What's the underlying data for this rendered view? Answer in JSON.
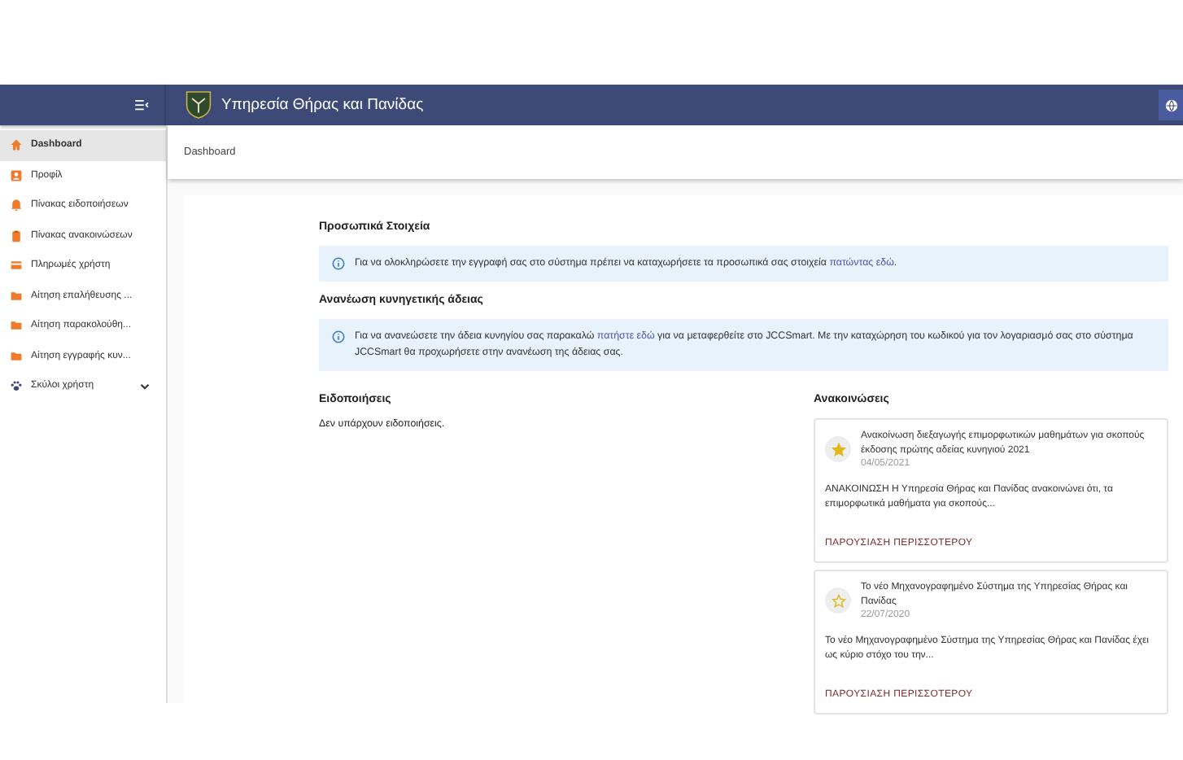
{
  "header": {
    "title": "Υπηρεσία Θήρας και Πανίδας"
  },
  "sidebar": {
    "items": [
      {
        "label": "Dashboard",
        "selected": true
      },
      {
        "label": "Προφίλ",
        "selected": false
      },
      {
        "label": "Πίνακας ειδοποιήσεων",
        "selected": false
      },
      {
        "label": "Πίνακας ανακοινώσεων",
        "selected": false
      },
      {
        "label": "Πληρωμές χρήστη",
        "selected": false
      },
      {
        "label": "Αίτηση επαλήθευσης ...",
        "selected": false
      },
      {
        "label": "Αίτηση παρακολούθη...",
        "selected": false
      },
      {
        "label": "Αίτηση εγγραφής κυν...",
        "selected": false
      },
      {
        "label": "Σκύλοι χρήστη",
        "selected": false,
        "expanded": false
      }
    ]
  },
  "breadcrumb": "Dashboard",
  "sections": [
    {
      "title": "Προσωπικά Στοιχεία",
      "info": {
        "before": "Για να ολοκληρώσετε την εγγραφή σας στο σύστημα πρέπει να καταχωρήσετε τα προσωπικά σας στοιχεία ",
        "link": "πατώντας εδώ",
        "after": "."
      }
    },
    {
      "title": "Ανανέωση κυνηγετικής άδειας",
      "info": {
        "before": "Για να ανανεώσετε την άδεια κυνηγίου σας παρακαλώ ",
        "link": "πατήστε εδώ",
        "after": " για να μεταφερθείτε στο JCCSmart. Με την καταχώρηση του κωδικού για τον λογαριασμό σας στο σύστημα JCCSmart θα προχωρήσετε στην ανανέωση της άδειας σας."
      }
    }
  ],
  "notifications": {
    "title": "Ειδοποιήσεις",
    "empty": "Δεν υπάρχουν ειδοποιήσεις."
  },
  "announcements": {
    "title": "Ανακοινώσεις",
    "items": [
      {
        "title": "Ανακοίνωση διεξαγωγής επιμορφωτικών μαθημάτων για σκοπούς έκδοσης πρώτης αδείας κυνηγιού 2021",
        "date": "04/05/2021",
        "starred": true,
        "body": "ΑΝΑΚΟΙΝΩΣΗ Η Υπηρεσία Θήρας και Πανίδας ανακοινώνει ότι, τα επιμορφωτικά μαθήματα για σκοπούς...",
        "more": "ΠΑΡΟΥΣΙΑΣΗ ΠΕΡΙΣΣΟΤΕΡΟΥ"
      },
      {
        "title": "Το νέο Μηχανογραφημένο Σύστημα της Υπηρεσίας Θήρας και Πανίδας",
        "date": "22/07/2020",
        "starred": false,
        "body": "Το νέο Μηχανογραφημένο Σύστημα της Υπηρεσίας Θήρας και Πανίδας έχει ως κύριο στόχο του την...",
        "more": "ΠΑΡΟΥΣΙΑΣΗ ΠΕΡΙΣΣΟΤΕΡΟΥ"
      }
    ]
  }
}
